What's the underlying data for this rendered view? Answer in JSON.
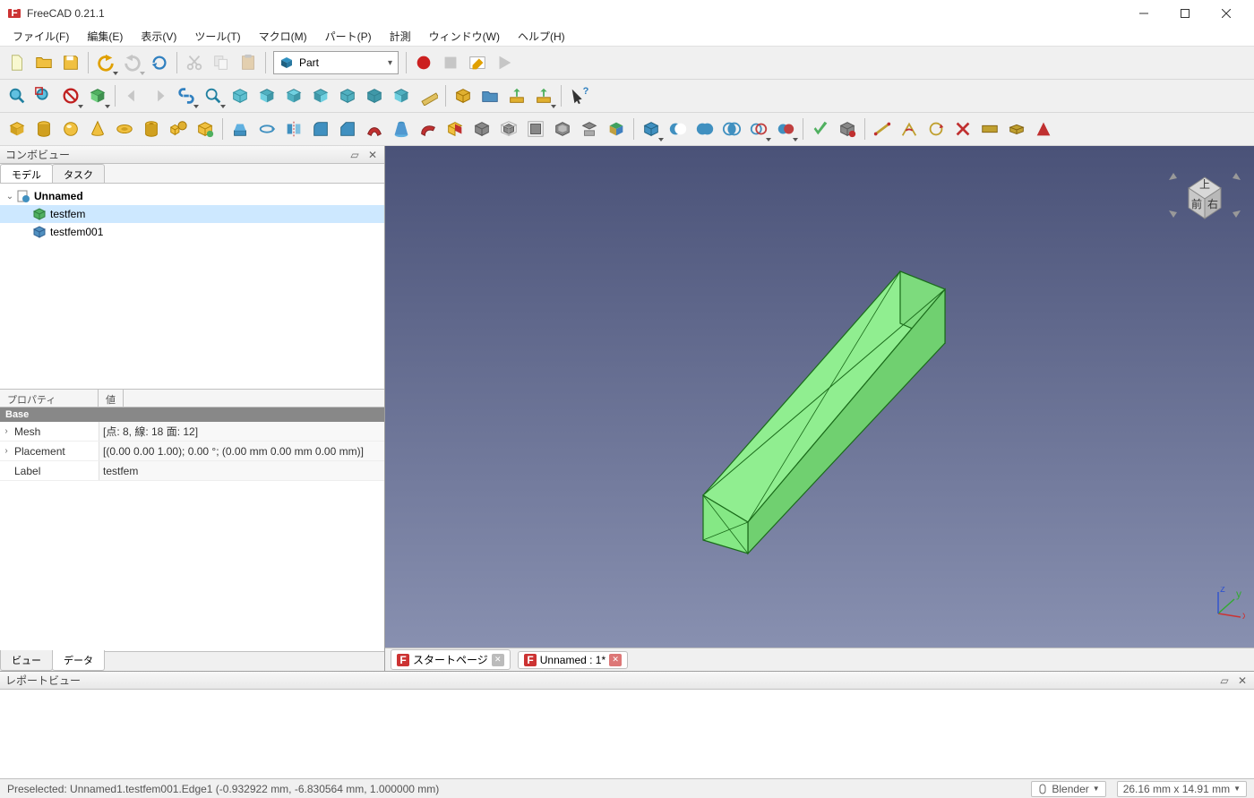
{
  "window": {
    "title": "FreeCAD 0.21.1"
  },
  "menu": [
    "ファイル(F)",
    "編集(E)",
    "表示(V)",
    "ツール(T)",
    "マクロ(M)",
    "パート(P)",
    "計測",
    "ウィンドウ(W)",
    "ヘルプ(H)"
  ],
  "workbench_selector": "Part",
  "panels": {
    "combo_title": "コンボビュー",
    "combo_tabs": [
      "モデル",
      "タスク"
    ],
    "report_title": "レポートビュー",
    "prop_headers": [
      "プロパティ",
      "値"
    ],
    "prop_group": "Base",
    "bottom_tabs": [
      "ビュー",
      "データ"
    ]
  },
  "tree": {
    "root": "Unnamed",
    "items": [
      "testfem",
      "testfem001"
    ]
  },
  "properties": [
    {
      "expandable": true,
      "key": "Mesh",
      "value": "[点: 8, 線: 18 面: 12]"
    },
    {
      "expandable": true,
      "key": "Placement",
      "value": "[(0.00 0.00 1.00); 0.00 °; (0.00 mm  0.00 mm  0.00 mm)]"
    },
    {
      "expandable": false,
      "key": "Label",
      "value": "testfem"
    }
  ],
  "doc_tabs": [
    {
      "label": "スタートページ",
      "dirty": false
    },
    {
      "label": "Unnamed : 1*",
      "dirty": true
    }
  ],
  "status": {
    "preselect": "Preselected: Unnamed1.testfem001.Edge1 (-0.932922 mm, -6.830564 mm, 1.000000 mm)",
    "nav_style": "Blender",
    "dimensions": "26.16 mm x 14.91 mm"
  },
  "navcube": {
    "top": "上",
    "front": "前",
    "right": "右"
  }
}
